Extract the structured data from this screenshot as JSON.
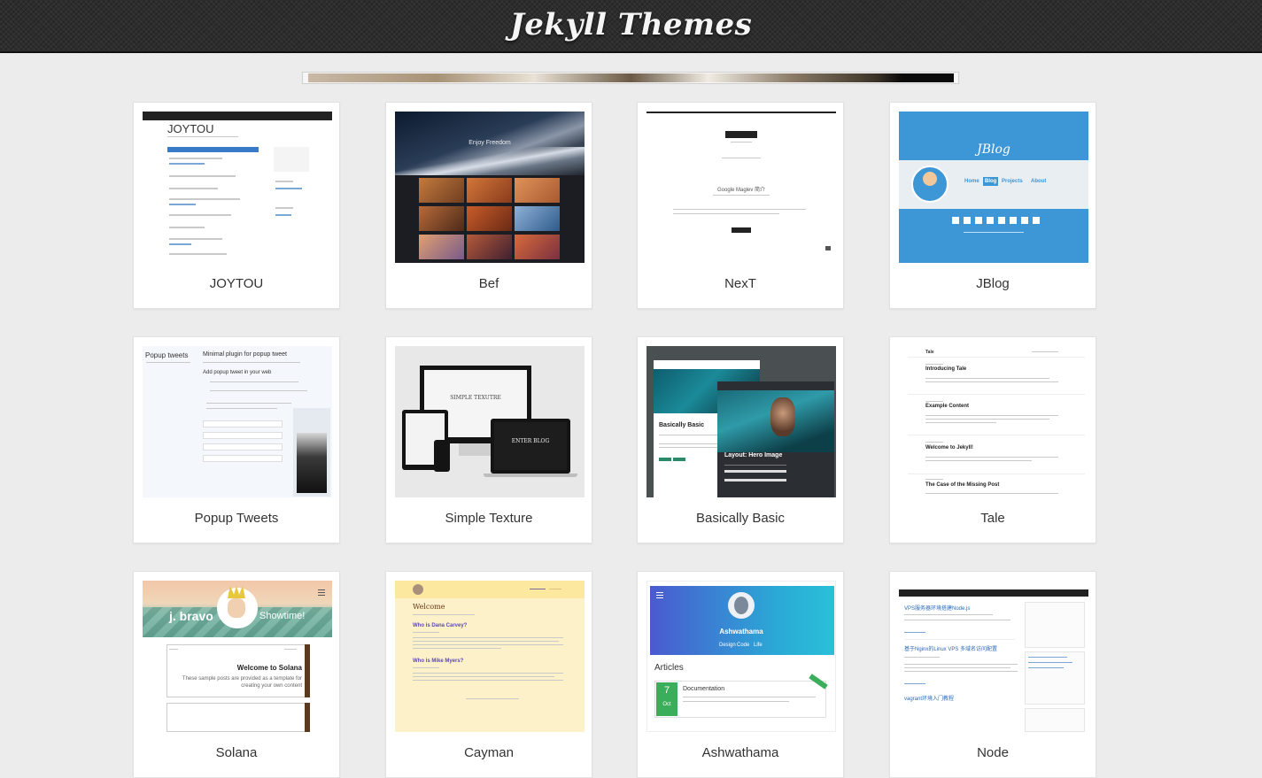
{
  "header": {
    "title": "Jekyll Themes"
  },
  "themes": [
    {
      "name": "JOYTOU",
      "thumb_title": "JOYTOU"
    },
    {
      "name": "Bef",
      "thumb_title": "Enjoy Freedom"
    },
    {
      "name": "NexT",
      "thumb_title": "Google Maglev 简介"
    },
    {
      "name": "JBlog",
      "thumb_title": "JBlog",
      "nav": [
        "Home",
        "Blog",
        "Projects",
        "About"
      ]
    },
    {
      "name": "Popup Tweets",
      "thumb_title": "Popup tweets",
      "thumb_heading": "Minimal plugin for popup tweet",
      "thumb_sub": "Add popup tweet in your web"
    },
    {
      "name": "Simple Texture",
      "thumb_title": "SIMPLE TEXUTRE",
      "thumb_button": "ENTER BLOG"
    },
    {
      "name": "Basically Basic",
      "thumb_title": "Basically Basic",
      "thumb_heading": "Layout: Hero Image"
    },
    {
      "name": "Tale",
      "thumb_title": "Tale",
      "posts": [
        "Introducing Tale",
        "Example Content",
        "Welcome to Jekyll!",
        "The Case of the Missing Post"
      ]
    },
    {
      "name": "Solana",
      "thumb_title": "j. bravo",
      "thumb_tagline": "Showtime!",
      "thumb_heading": "Welcome to Solana",
      "thumb_text": "These sample posts are provided as a template for creating your own content"
    },
    {
      "name": "Cayman",
      "thumb_title": "Welcome",
      "posts": [
        "Who is Dana Carvey?",
        "Who is Mike Myers?"
      ]
    },
    {
      "name": "Ashwathama",
      "thumb_title": "Ashwathama",
      "nav": [
        "Design",
        "Code",
        "Life"
      ],
      "thumb_heading": "Articles",
      "thumb_day": "7",
      "thumb_month": "Oct",
      "thumb_post": "Documentation"
    },
    {
      "name": "Node",
      "posts": [
        "VPS服务器环境搭建Node.js",
        "基于Nginx的Linux VPS 多域名访问配置",
        "vagrant环境入门教程"
      ]
    }
  ]
}
